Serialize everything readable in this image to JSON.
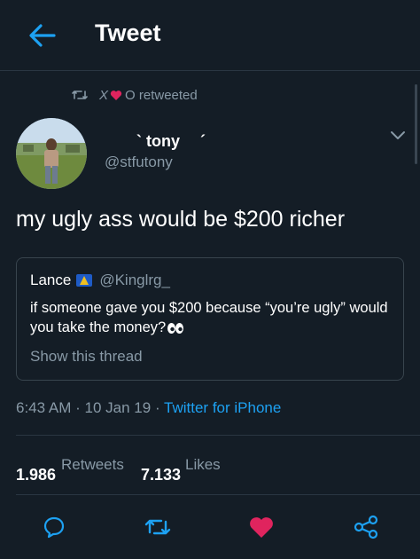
{
  "header": {
    "title": "Tweet"
  },
  "retweet_context": {
    "prefix": "X",
    "suffix": "O retweeted"
  },
  "author": {
    "display_name": "  ` tony  ´ ",
    "handle": "@stfutony"
  },
  "tweet": {
    "text": "my ugly ass would be $200 richer"
  },
  "quote": {
    "name": "Lance",
    "handle": "@Kinglrg_",
    "text": "if someone gave you $200 because “you’re ugly” would you take the money?",
    "show_thread": "Show this thread"
  },
  "meta": {
    "time": "6:43 AM",
    "sep1": "·",
    "date": "10 Jan 19",
    "sep2": "·",
    "source": "Twitter for iPhone"
  },
  "stats": {
    "retweets_count": "1,986",
    "retweets_label": "Retweets",
    "likes_count": "7,133",
    "likes_label": "Likes"
  },
  "actions": [
    {
      "icon": "reply-icon"
    },
    {
      "icon": "retweet-icon"
    },
    {
      "icon": "heart-icon"
    },
    {
      "icon": "share-icon"
    }
  ],
  "colors": {
    "background": "#141d26",
    "accent": "#1da1f2",
    "like": "#e0245e",
    "muted": "#8899a6"
  }
}
